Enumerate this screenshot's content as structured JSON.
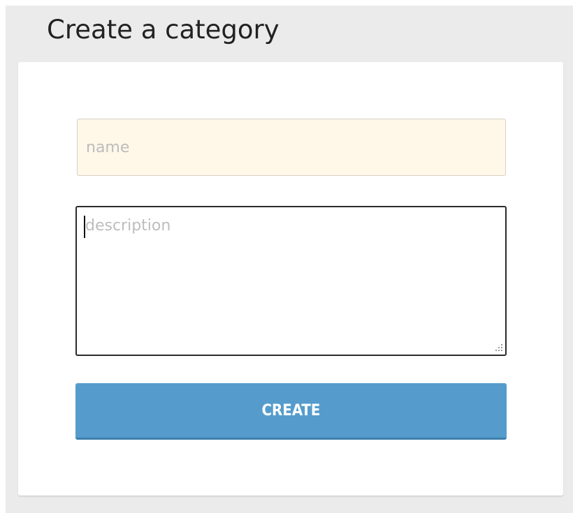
{
  "page": {
    "title": "Create a category"
  },
  "form": {
    "name_field": {
      "value": "",
      "placeholder": "name"
    },
    "description_field": {
      "value": "",
      "placeholder": "description"
    },
    "submit_label": "CREATE"
  },
  "colors": {
    "background": "#ebebeb",
    "card": "#ffffff",
    "name_field_fill": "#fff7e8",
    "button": "#559ccd",
    "button_text": "#ffffff"
  },
  "icons": {
    "resize_grip": "resize-grip-icon"
  }
}
